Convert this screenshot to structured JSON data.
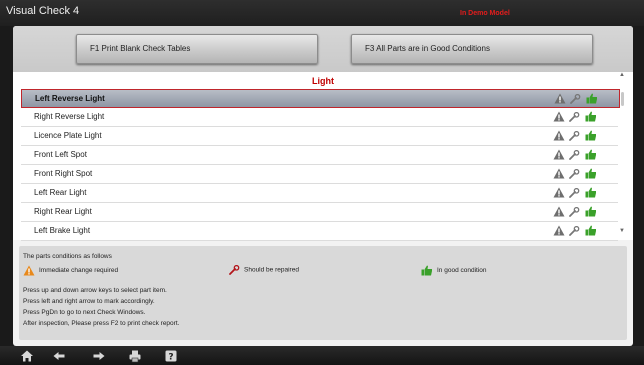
{
  "window": {
    "title": "Visual Check 4",
    "mode_notice": "In Demo Model"
  },
  "toolbar": {
    "f1_label": "F1   Print Blank Check Tables",
    "f3_label": "F3   All Parts are in Good Conditions"
  },
  "section": {
    "title": "Light"
  },
  "parts": [
    {
      "label": "Left Reverse Light",
      "selected": true
    },
    {
      "label": "Right Reverse Light",
      "selected": false
    },
    {
      "label": "Licence Plate Light",
      "selected": false
    },
    {
      "label": "Front Left Spot",
      "selected": false
    },
    {
      "label": "Front Right Spot",
      "selected": false
    },
    {
      "label": "Left Rear Light",
      "selected": false
    },
    {
      "label": "Right Rear Light",
      "selected": false
    },
    {
      "label": "Left Brake Light",
      "selected": false
    }
  ],
  "legend": {
    "heading": "The parts conditions as follows",
    "immediate": "Immediate change required",
    "repair": "Should be repaired",
    "good": "In good condition"
  },
  "instructions": [
    "Press up and down arrow keys to select part item.",
    "Press left and right arrow to mark accordingly.",
    "Press PgDn to go to next Check Windows.",
    "After inspection, Please press F2 to print check report."
  ],
  "colors": {
    "warning": "#e8891c",
    "warning_gray": "#6e6e6e",
    "repair": "#b3151b",
    "good": "#3aa12a",
    "demo_text": "#e41c1c",
    "section_title": "#c00000"
  },
  "icons": {
    "row_actions": [
      "warning-icon",
      "wrench-icon",
      "thumbs-up-icon"
    ],
    "bottom_bar": [
      "home-icon",
      "back-arrow-icon",
      "forward-arrow-icon",
      "print-icon",
      "help-icon"
    ]
  }
}
